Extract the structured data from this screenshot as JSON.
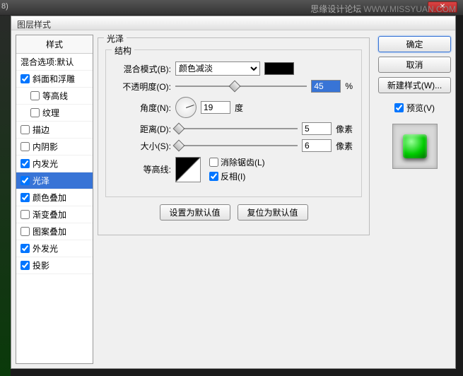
{
  "watermark": {
    "ch": "思缘设计论坛",
    "url": "WWW.MISSYUAN.COM"
  },
  "window": {
    "title_suffix": "8)"
  },
  "dialog": {
    "title": "图层样式"
  },
  "sidebar": {
    "header": "样式",
    "items": [
      {
        "label": "混合选项:默认",
        "checked": null
      },
      {
        "label": "斜面和浮雕",
        "checked": true
      },
      {
        "label": "等高线",
        "checked": false,
        "indent": true
      },
      {
        "label": "纹理",
        "checked": false,
        "indent": true
      },
      {
        "label": "描边",
        "checked": false
      },
      {
        "label": "内阴影",
        "checked": false
      },
      {
        "label": "内发光",
        "checked": true
      },
      {
        "label": "光泽",
        "checked": true,
        "selected": true
      },
      {
        "label": "颜色叠加",
        "checked": true
      },
      {
        "label": "渐变叠加",
        "checked": false
      },
      {
        "label": "图案叠加",
        "checked": false
      },
      {
        "label": "外发光",
        "checked": true
      },
      {
        "label": "投影",
        "checked": true
      }
    ]
  },
  "panel": {
    "title": "光泽",
    "structure": "结构",
    "blend_label": "混合模式(B):",
    "blend_value": "颜色减淡",
    "swatch_color": "#000000",
    "opacity_label": "不透明度(O):",
    "opacity_value": "45",
    "opacity_unit": "%",
    "angle_label": "角度(N):",
    "angle_value": "19",
    "angle_unit": "度",
    "distance_label": "距离(D):",
    "distance_value": "5",
    "distance_unit": "像素",
    "size_label": "大小(S):",
    "size_value": "6",
    "size_unit": "像素",
    "contour_label": "等高线:",
    "antialias_label": "消除锯齿(L)",
    "invert_label": "反相(I)",
    "invert_checked": true,
    "btn_default": "设置为默认值",
    "btn_reset": "复位为默认值"
  },
  "buttons": {
    "ok": "确定",
    "cancel": "取消",
    "new_style": "新建样式(W)...",
    "preview": "预览(V)"
  }
}
